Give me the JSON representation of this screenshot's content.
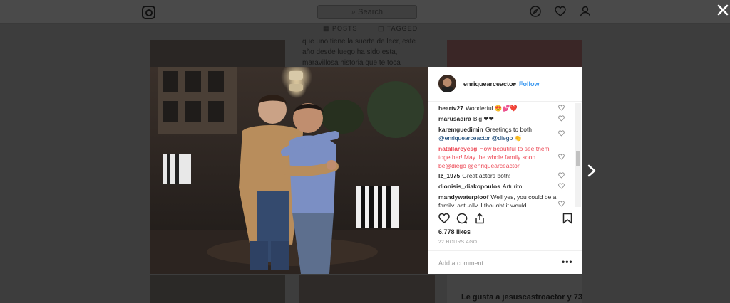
{
  "background": {
    "search_placeholder": "Search",
    "tabs": [
      "POSTS",
      "TAGGED"
    ],
    "caption_excerpt": "que uno tiene la suerte de leer, este año desde luego ha sido esta, maravillosa historia que te toca",
    "bottom_likes": "Le gusta a jesuscastroactor y 73"
  },
  "post": {
    "username": "enriquearceactor",
    "separator": "•",
    "follow_label": "Follow",
    "comments": [
      {
        "user": "heartv27",
        "text": "Wonderful 😍💕❤️"
      },
      {
        "user": "marusadira",
        "text": "Big ❤❤"
      },
      {
        "user": "karemguedimin",
        "text": "Greetings to both",
        "links": "@enriquearceactor @diego 👏"
      },
      {
        "user": "natallareyesg",
        "text": "How beautiful to see them together! May the whole family soon be@diego @enriquearceactor"
      },
      {
        "user": "lz_1975",
        "text": "Great actors both!"
      },
      {
        "user": "dionisis_diakopoulos",
        "text": "Arturito"
      },
      {
        "user": "mandywaterploof",
        "text": "Well yes, you could be a family, actually, I thought it would"
      }
    ],
    "likes": "6,778 likes",
    "time": "22 HOURS AGO",
    "add_comment_placeholder": "Add a comment...",
    "more": "•••"
  },
  "icons": [
    "instagram-logo",
    "compass-icon",
    "heart-icon",
    "user-icon",
    "close-icon",
    "chevron-right-icon",
    "comment-icon",
    "share-icon",
    "bookmark-icon"
  ],
  "colors": {
    "accent": "#3897f0",
    "red": "#ed4956",
    "overlay": "#3d3d3d"
  }
}
